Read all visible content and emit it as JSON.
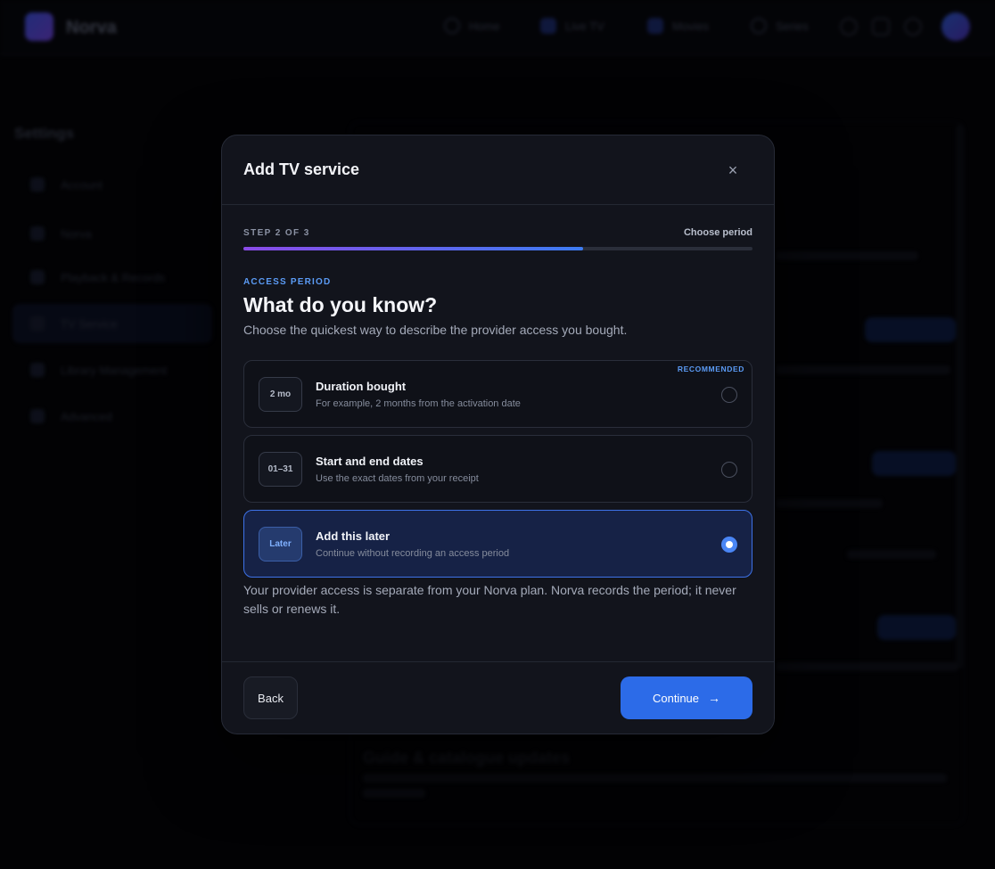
{
  "background": {
    "app_name": "Norva",
    "nav": [
      {
        "label": "Home"
      },
      {
        "label": "Live TV"
      },
      {
        "label": "Movies"
      },
      {
        "label": "Series"
      }
    ],
    "settings_title": "Settings",
    "sidebar": [
      {
        "label": "Account"
      },
      {
        "label": "Norva"
      },
      {
        "label": "Playback & Records"
      },
      {
        "label": "TV Service"
      },
      {
        "label": "Library Management"
      },
      {
        "label": "Advanced"
      }
    ],
    "section_heading": "Guide & catalogue updates"
  },
  "modal": {
    "title": "Add TV service",
    "close_symbol": "×",
    "step_label": "STEP 2 OF 3",
    "step_name": "Choose period",
    "progress": 0.667,
    "eyebrow": "ACCESS PERIOD",
    "question": "What do you know?",
    "question_sub": "Choose the quickest way to describe the provider access you bought.",
    "options": [
      {
        "badge": "2 mo",
        "title": "Duration bought",
        "description": "For example, 2 months from the activation date",
        "tag": "RECOMMENDED",
        "selected": false
      },
      {
        "badge": "01–31",
        "title": "Start and end dates",
        "description": "Use the exact dates from your receipt",
        "tag": "",
        "selected": false
      },
      {
        "badge": "Later",
        "title": "Add this later",
        "description": "Continue without recording an access period",
        "tag": "",
        "selected": true
      }
    ],
    "note": "Your provider access is separate from your Norva plan. Norva records the period; it never sells or renews it.",
    "back_label": "Back",
    "continue_label": "Continue",
    "continue_arrow": "→"
  },
  "colors": {
    "accent": "#2c6be8",
    "eyebrow": "#5b9bf5",
    "selected_border": "#3d72e8",
    "modal_bg": "#12141c"
  }
}
